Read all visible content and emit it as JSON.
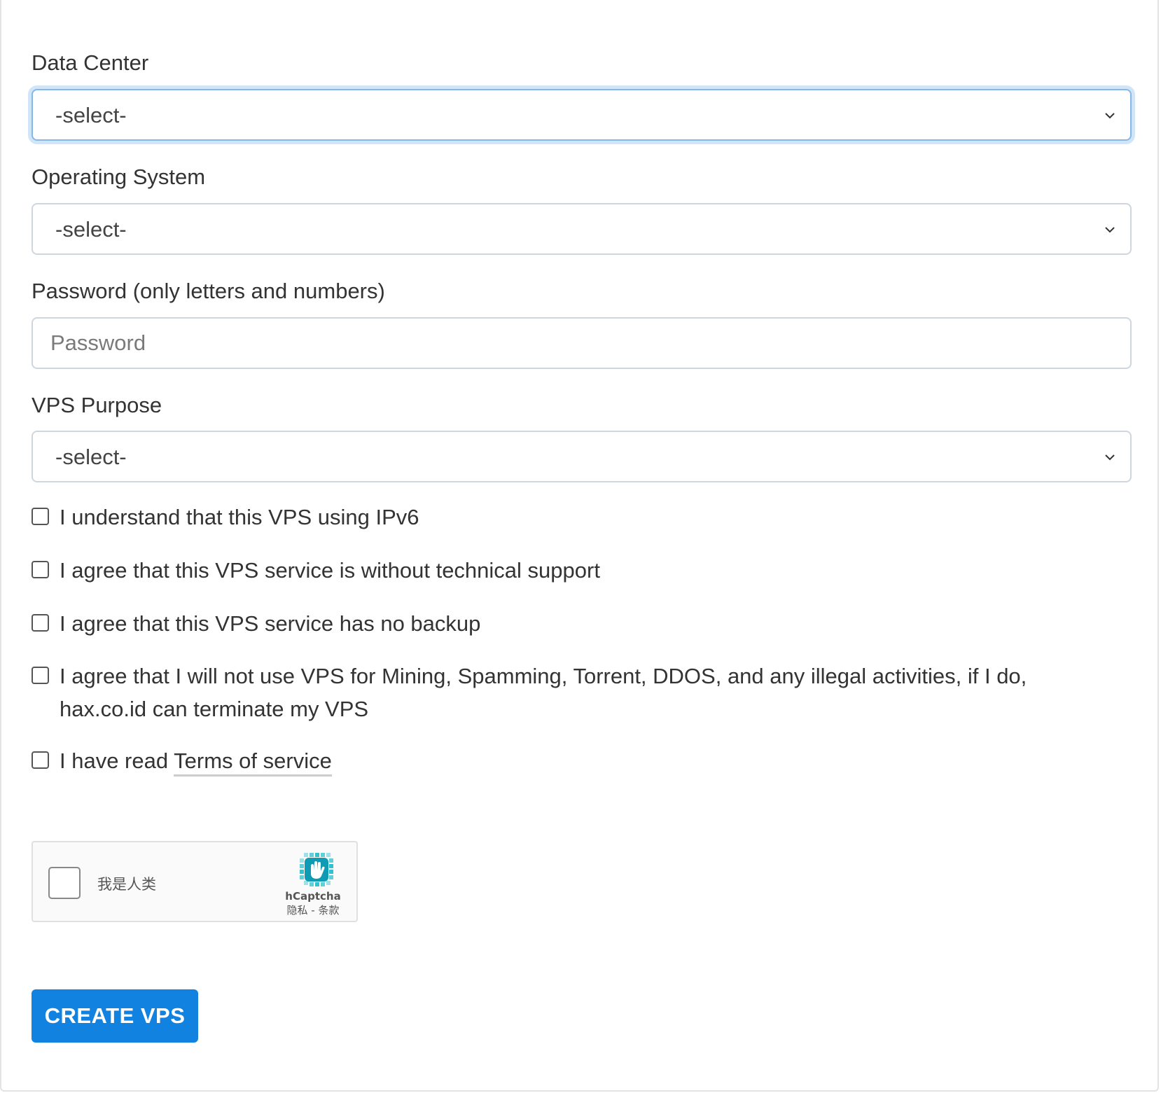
{
  "form": {
    "data_center": {
      "label": "Data Center",
      "value": "-select-"
    },
    "operating_system": {
      "label": "Operating System",
      "value": "-select-"
    },
    "password": {
      "label": "Password (only letters and numbers)",
      "placeholder": "Password",
      "value": ""
    },
    "vps_purpose": {
      "label": "VPS Purpose",
      "value": "-select-"
    },
    "checks": {
      "ipv6": "I understand that this VPS using IPv6",
      "no_support": "I agree that this VPS service is without technical support",
      "no_backup": "I agree that this VPS service has no backup",
      "no_abuse": "I agree that I will not use VPS for Mining, Spamming, Torrent, DDOS, and any illegal activities, if I do, hax.co.id can terminate my VPS",
      "tos_prefix": "I have read ",
      "tos_link": "Terms of service"
    },
    "captcha": {
      "label": "我是人类",
      "brand": "hCaptcha",
      "links": "隐私 - 条款"
    },
    "submit_label": "CREATE VPS"
  },
  "colors": {
    "primary": "#1182e0",
    "focus_ring": "#86b7e8",
    "border": "#cfd6de"
  }
}
